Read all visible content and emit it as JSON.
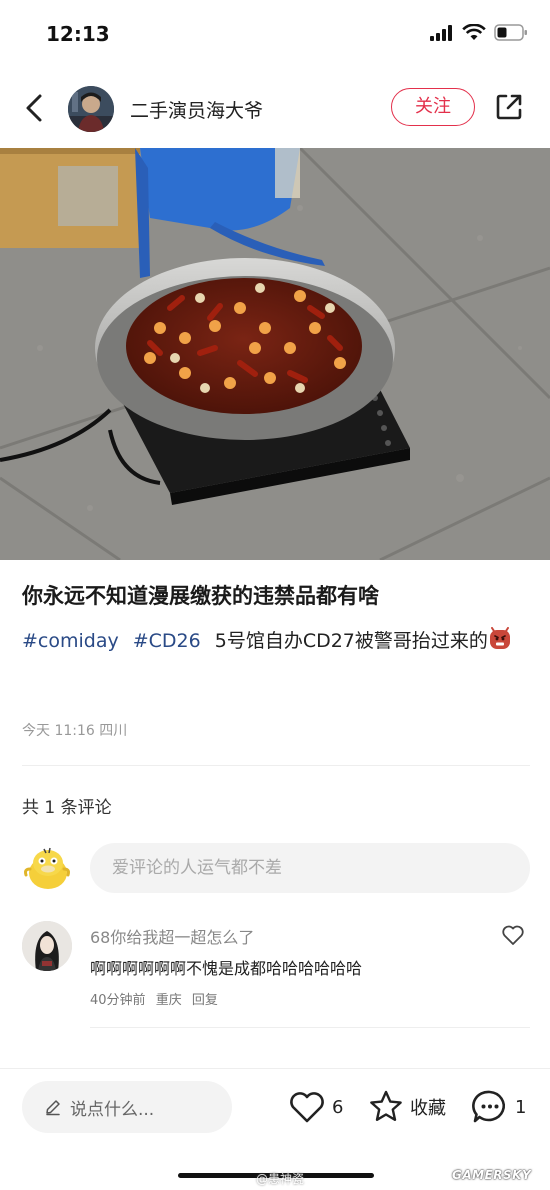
{
  "status_bar": {
    "time": "12:13"
  },
  "nav": {
    "author_name": "二手演员海大爷",
    "follow_label": "关注"
  },
  "post": {
    "title": "你永远不知道漫展缴获的违禁品都有啥",
    "hashtags": [
      "#comiday",
      "#CD26"
    ],
    "text": "5号馆自办CD27被警哥抬过来的",
    "time": "今天 11:16",
    "location": "四川"
  },
  "comments": {
    "count_label": "共 1 条评论",
    "input_placeholder": "爱评论的人运气都不差",
    "items": [
      {
        "user": "68你给我超一超怎么了",
        "text": "啊啊啊啊啊啊不愧是成都哈哈哈哈哈哈",
        "time": "40分钟前",
        "location": "重庆",
        "reply_label": "回复"
      }
    ]
  },
  "bottom_bar": {
    "say_placeholder": "说点什么...",
    "like_count": "6",
    "collect_label": "收藏",
    "comment_count": "1"
  },
  "watermark": {
    "handle": "@患神瓷",
    "logo": "GAMERSKY"
  },
  "colors": {
    "accent": "#e3304b",
    "hashtag": "#2a4a86"
  }
}
